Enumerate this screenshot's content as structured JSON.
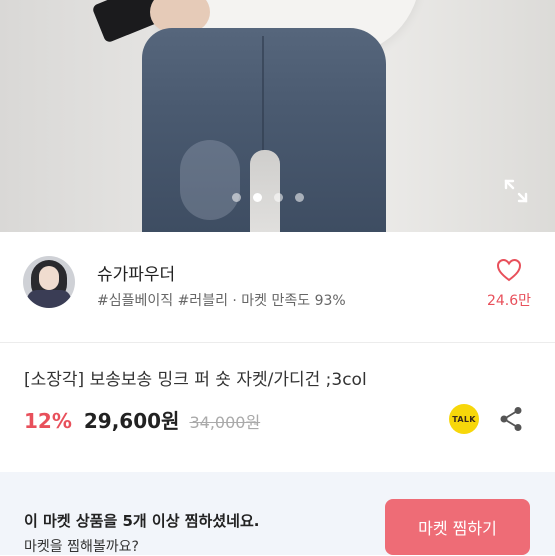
{
  "carousel": {
    "slide_count": 4,
    "active_index": 1
  },
  "shop": {
    "name": "슈가파우더",
    "meta": "#심플베이직 #러블리 · 마켓 만족도 93%",
    "like_count": "24.6만"
  },
  "product": {
    "title": "[소장각] 보송보송 밍크 퍼 숏 자켓/가디건 ;3col",
    "discount": "12%",
    "price": "29,600원",
    "original_price": "34,000원"
  },
  "actions": {
    "talk_label": "TALK"
  },
  "banner": {
    "line1": "이 마켓 상품을 5개 이상 찜하셨네요.",
    "line2": "마켓을 찜해볼까요?",
    "button_label": "마켓 찜하기"
  },
  "colors": {
    "accent": "#e8505b",
    "button": "#ee6c76",
    "talk": "#f7d70a",
    "banner_bg": "#f2f5fa"
  },
  "icons": [
    "expand-icon",
    "heart-icon",
    "kakao-talk-icon",
    "share-icon"
  ]
}
